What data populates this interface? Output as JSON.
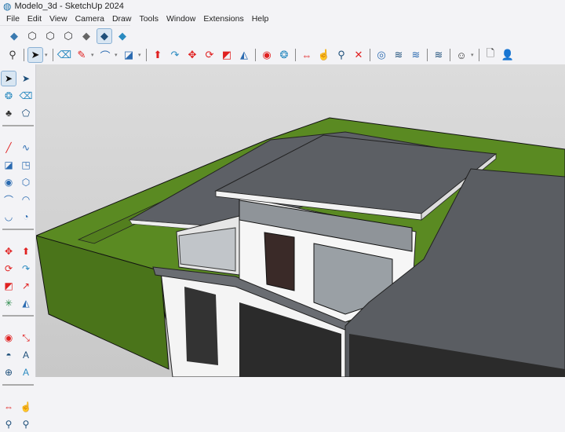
{
  "window": {
    "title": "Modelo_3d - SketchUp 2024"
  },
  "menu": [
    "File",
    "Edit",
    "View",
    "Camera",
    "Draw",
    "Tools",
    "Window",
    "Extensions",
    "Help"
  ],
  "colors": {
    "accent": "#1a6fa8",
    "red_tool": "#e02020",
    "sky": "#d3d3d3",
    "grass": "#4d7a1c",
    "roof": "#5a5d62"
  },
  "views_toolbar": [
    {
      "icon": "iso-icon",
      "glyph": "◆",
      "color": "#3a7ab0"
    },
    {
      "icon": "top-view-icon",
      "glyph": "⬡",
      "color": "#333"
    },
    {
      "icon": "front-view-icon",
      "glyph": "⬡",
      "color": "#333"
    },
    {
      "icon": "right-view-icon",
      "glyph": "⬡",
      "color": "#333"
    },
    {
      "icon": "back-view-icon",
      "glyph": "◆",
      "color": "#666"
    },
    {
      "icon": "left-view-icon",
      "glyph": "◆",
      "color": "#1e4f7a",
      "selected": true
    },
    {
      "icon": "bottom-view-icon",
      "glyph": "◆",
      "color": "#2a8ac0"
    }
  ],
  "main_toolbar": [
    {
      "icon": "zoom-icon",
      "glyph": "⚲",
      "color": "#333"
    },
    {
      "sep": true
    },
    {
      "icon": "select-icon",
      "glyph": "➤",
      "color": "#111",
      "selected": true
    },
    {
      "dd": true
    },
    {
      "sep": true
    },
    {
      "icon": "eraser-icon",
      "glyph": "⌫",
      "color": "#2a8ac0"
    },
    {
      "icon": "pencil-icon",
      "glyph": "✎",
      "color": "#e02020"
    },
    {
      "dd": true
    },
    {
      "icon": "arc-icon",
      "glyph": "⌒",
      "color": "#2a6ab0"
    },
    {
      "dd": true
    },
    {
      "icon": "rectangle-icon",
      "glyph": "◪",
      "color": "#2a6ab0"
    },
    {
      "dd": true
    },
    {
      "sep": true
    },
    {
      "icon": "push-pull-icon",
      "glyph": "⬆",
      "color": "#e02020"
    },
    {
      "icon": "follow-me-icon",
      "glyph": "↷",
      "color": "#2a8ac0"
    },
    {
      "icon": "move-icon",
      "glyph": "✥",
      "color": "#e02020"
    },
    {
      "icon": "rotate-icon",
      "glyph": "⟳",
      "color": "#e02020"
    },
    {
      "icon": "scale-icon",
      "glyph": "◩",
      "color": "#e02020"
    },
    {
      "icon": "offset-icon",
      "glyph": "◭",
      "color": "#2a6ab0"
    },
    {
      "sep": true
    },
    {
      "icon": "tape-measure-icon",
      "glyph": "◉",
      "color": "#e02020"
    },
    {
      "icon": "paint-bucket-icon",
      "glyph": "❂",
      "color": "#2a8ac0"
    },
    {
      "sep": true
    },
    {
      "icon": "orbit-icon",
      "glyph": "⇔",
      "color": "#e02020"
    },
    {
      "icon": "pan-icon",
      "glyph": "☝",
      "color": "#e02020"
    },
    {
      "icon": "zoom-tool-icon",
      "glyph": "⚲",
      "color": "#1e4f7a"
    },
    {
      "icon": "zoom-extents-icon",
      "glyph": "✕",
      "color": "#e02020"
    },
    {
      "sep": true
    },
    {
      "icon": "3d-warehouse-icon",
      "glyph": "◎",
      "color": "#2a6ab0"
    },
    {
      "icon": "extension-warehouse-icon",
      "glyph": "≋",
      "color": "#1e4f7a"
    },
    {
      "icon": "layout-icon",
      "glyph": "≋",
      "color": "#2a6ab0"
    },
    {
      "sep": true
    },
    {
      "icon": "extension-manager-icon",
      "glyph": "≋",
      "color": "#1e4f7a"
    },
    {
      "sep": true
    },
    {
      "icon": "account-icon",
      "glyph": "☺",
      "color": "#333"
    },
    {
      "dd": true
    },
    {
      "sep": true
    },
    {
      "icon": "new-file-icon",
      "glyph": "🗋",
      "color": "#333"
    },
    {
      "icon": "add-user-icon",
      "glyph": "👤",
      "color": "#1e4f7a"
    }
  ],
  "side_toolbar": [
    {
      "icon": "select-icon",
      "glyph": "➤",
      "color": "#111",
      "selected": true
    },
    {
      "icon": "lasso-select-icon",
      "glyph": "➤",
      "color": "#1e4f7a"
    },
    {
      "icon": "paint-bucket-icon",
      "glyph": "❂",
      "color": "#2a8ac0"
    },
    {
      "icon": "eraser-icon",
      "glyph": "⌫",
      "color": "#2a8ac0"
    },
    {
      "icon": "make-component-icon",
      "glyph": "♣",
      "color": "#333"
    },
    {
      "icon": "tag-icon",
      "glyph": "⬠",
      "color": "#1e4f7a"
    },
    {
      "sep": true
    },
    {
      "icon": "line-icon",
      "glyph": "╱",
      "color": "#e02020"
    },
    {
      "icon": "freehand-icon",
      "glyph": "∿",
      "color": "#2a6ab0"
    },
    {
      "icon": "rectangle-icon",
      "glyph": "◪",
      "color": "#2a6ab0"
    },
    {
      "icon": "rotated-rectangle-icon",
      "glyph": "◳",
      "color": "#2a6ab0"
    },
    {
      "icon": "circle-icon",
      "glyph": "◉",
      "color": "#2a6ab0"
    },
    {
      "icon": "polygon-icon",
      "glyph": "⬡",
      "color": "#2a6ab0"
    },
    {
      "icon": "arc-icon",
      "glyph": "⌒",
      "color": "#2a6ab0"
    },
    {
      "icon": "2-point-arc-icon",
      "glyph": "◠",
      "color": "#2a6ab0"
    },
    {
      "icon": "3-point-arc-icon",
      "glyph": "◡",
      "color": "#2a6ab0"
    },
    {
      "icon": "pie-icon",
      "glyph": "◔",
      "color": "#2a6ab0"
    },
    {
      "sep": true
    },
    {
      "icon": "move-icon",
      "glyph": "✥",
      "color": "#e02020"
    },
    {
      "icon": "push-pull-icon",
      "glyph": "⬆",
      "color": "#e02020"
    },
    {
      "icon": "rotate-icon",
      "glyph": "⟳",
      "color": "#e02020"
    },
    {
      "icon": "follow-me-icon",
      "glyph": "↷",
      "color": "#2a8ac0"
    },
    {
      "icon": "scale-icon",
      "glyph": "◩",
      "color": "#e02020"
    },
    {
      "icon": "offset-icon",
      "glyph": "↗",
      "color": "#e02020"
    },
    {
      "icon": "flip-icon",
      "glyph": "✳",
      "color": "#2a8a4a"
    },
    {
      "icon": "solid-tools-icon",
      "glyph": "◭",
      "color": "#2a6ab0"
    },
    {
      "sep": true
    },
    {
      "icon": "tape-measure-icon",
      "glyph": "◉",
      "color": "#e02020"
    },
    {
      "icon": "dimension-icon",
      "glyph": "⤡",
      "color": "#e02020"
    },
    {
      "icon": "protractor-icon",
      "glyph": "◓",
      "color": "#1e4f7a"
    },
    {
      "icon": "text-icon",
      "glyph": "A",
      "color": "#1e4f7a"
    },
    {
      "icon": "axes-icon",
      "glyph": "⊕",
      "color": "#1e4f7a"
    },
    {
      "icon": "3d-text-icon",
      "glyph": "A",
      "color": "#2a8ac0"
    },
    {
      "sep": true
    },
    {
      "icon": "orbit-icon",
      "glyph": "⇔",
      "color": "#e02020"
    },
    {
      "icon": "pan-icon",
      "glyph": "☝",
      "color": "#e02020"
    },
    {
      "icon": "zoom-icon",
      "glyph": "⚲",
      "color": "#1e4f7a"
    },
    {
      "icon": "zoom-window-icon",
      "glyph": "⚲",
      "color": "#1e4f7a"
    }
  ]
}
